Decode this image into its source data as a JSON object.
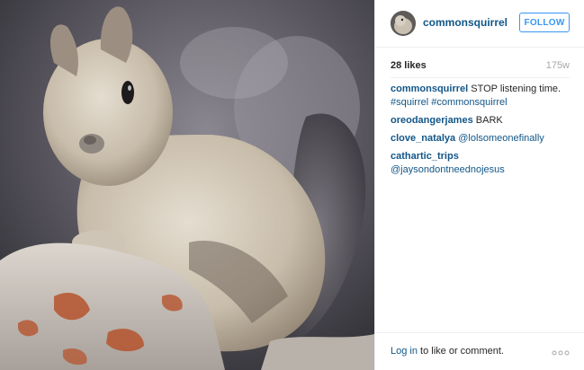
{
  "post": {
    "image_alt": "squirrel sitting on rocks",
    "username": "commonsquirrel",
    "follow_label": "FOLLOW",
    "likes": "28 likes",
    "time_ago": "175w",
    "caption": {
      "user": "commonsquirrel",
      "text": "STOP listening time.",
      "hashtags": "#squirrel #commonsquirrel"
    },
    "comments": [
      {
        "user": "oreodangerjames",
        "text": "BARK"
      },
      {
        "user": "clove_natalya",
        "text": "@lolsomeonefinally"
      },
      {
        "user": "cathartic_trips",
        "text": "@jaysondontneednojesus"
      }
    ]
  },
  "footer": {
    "login_link": "Log in",
    "login_rest": " to like or comment.",
    "more_icon": "more-horizontal-icon"
  },
  "colors": {
    "link": "#125688",
    "follow": "#3897f0",
    "border": "#efefef",
    "muted": "#a5a7aa"
  }
}
